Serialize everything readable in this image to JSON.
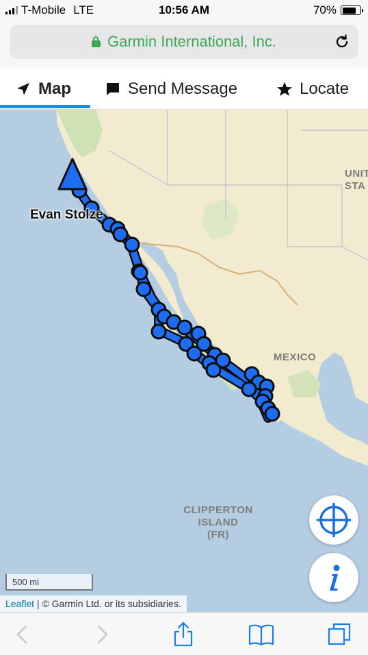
{
  "status": {
    "carrier": "T-Mobile",
    "network": "LTE",
    "time": "10:56 AM",
    "battery": "70%"
  },
  "browser": {
    "site_title": "Garmin International, Inc.",
    "secure_color": "#3aaa52",
    "icons": [
      "lock-icon",
      "reload-icon"
    ]
  },
  "tabs": [
    {
      "label": "Map",
      "icon": "navigate-arrow-icon",
      "active": true
    },
    {
      "label": "Send Message",
      "icon": "chat-bubble-icon",
      "active": false
    },
    {
      "label": "Locate",
      "icon": "star-icon",
      "active": false
    }
  ],
  "map": {
    "tracker_name": "Evan Stolze",
    "labels": {
      "country_mexico": "MEXICO",
      "country_us_line1": "UNIT",
      "country_us_line2": "STA",
      "island_line1": "CLIPPERTON",
      "island_line2": "ISLAND",
      "island_line3": "(FR)"
    },
    "scale_label": "500 mi",
    "attribution_link": "Leaflet",
    "attribution_text": " | © Garmin Ltd. or its subsidiaries.",
    "track_color": "#1e6cf0",
    "controls": [
      "crosshair-icon",
      "info-icon"
    ]
  },
  "toolbar": {
    "buttons": [
      "back-icon",
      "forward-icon",
      "share-icon",
      "bookmarks-icon",
      "tabs-icon"
    ]
  }
}
